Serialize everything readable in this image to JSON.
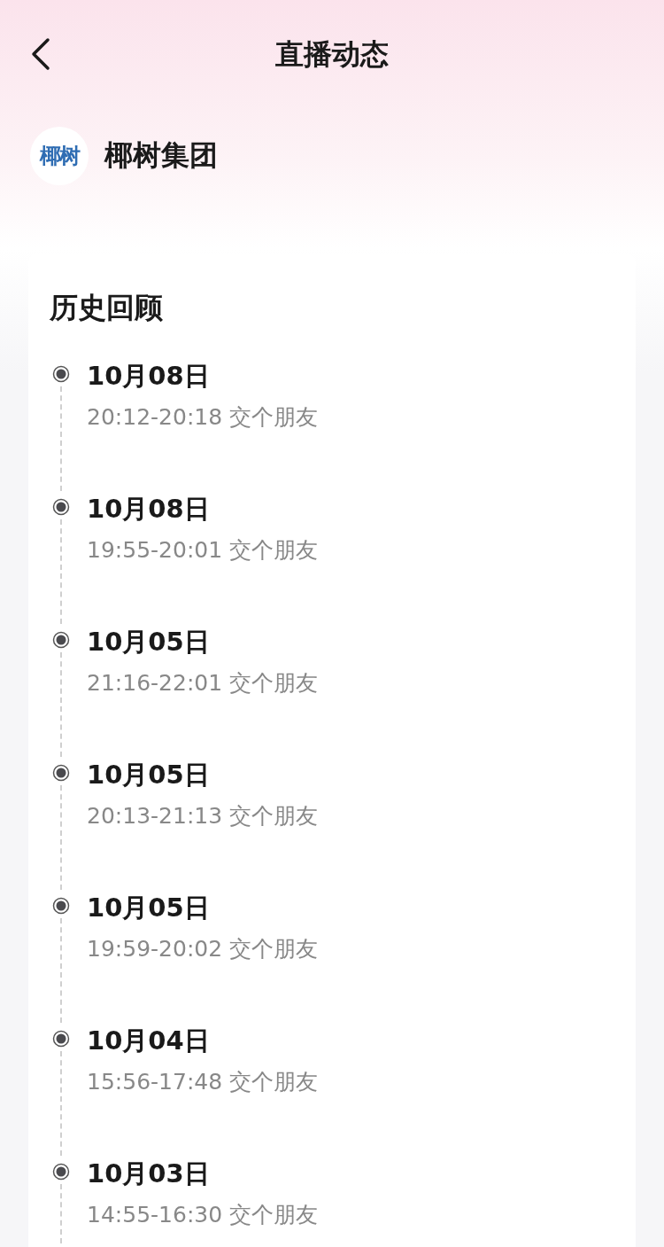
{
  "header": {
    "title": "直播动态"
  },
  "brand": {
    "logo_text": "椰树",
    "name": "椰树集团"
  },
  "history": {
    "title": "历史回顾",
    "items": [
      {
        "date": "10月08日",
        "detail": "20:12-20:18 交个朋友"
      },
      {
        "date": "10月08日",
        "detail": "19:55-20:01 交个朋友"
      },
      {
        "date": "10月05日",
        "detail": "21:16-22:01 交个朋友"
      },
      {
        "date": "10月05日",
        "detail": "20:13-21:13 交个朋友"
      },
      {
        "date": "10月05日",
        "detail": "19:59-20:02 交个朋友"
      },
      {
        "date": "10月04日",
        "detail": "15:56-17:48 交个朋友"
      },
      {
        "date": "10月03日",
        "detail": "14:55-16:30 交个朋友"
      }
    ]
  }
}
